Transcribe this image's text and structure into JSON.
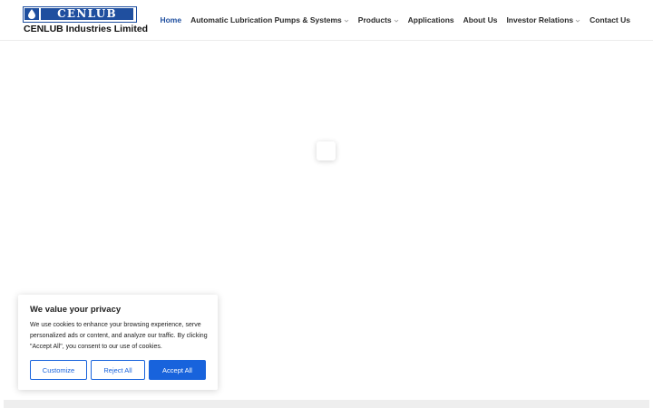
{
  "header": {
    "logo_text": "CENLUB",
    "company_name": "CENLUB Industries Limited",
    "brand_color": "#1f4f9f"
  },
  "nav": {
    "items": [
      {
        "label": "Home",
        "active": true,
        "dropdown": false
      },
      {
        "label": "Automatic Lubrication Pumps & Systems",
        "active": false,
        "dropdown": true
      },
      {
        "label": "Products",
        "active": false,
        "dropdown": true
      },
      {
        "label": "Applications",
        "active": false,
        "dropdown": false
      },
      {
        "label": "About Us",
        "active": false,
        "dropdown": false
      },
      {
        "label": "Investor Relations",
        "active": false,
        "dropdown": true
      },
      {
        "label": "Contact Us",
        "active": false,
        "dropdown": false
      }
    ]
  },
  "cookie": {
    "title": "We value your privacy",
    "text": "We use cookies to enhance your browsing experience, serve personalized ads or content, and analyze our traffic. By clicking \"Accept All\", you consent to our use of cookies.",
    "customize_label": "Customize",
    "reject_label": "Reject All",
    "accept_label": "Accept All",
    "accent_color": "#1863dc"
  }
}
